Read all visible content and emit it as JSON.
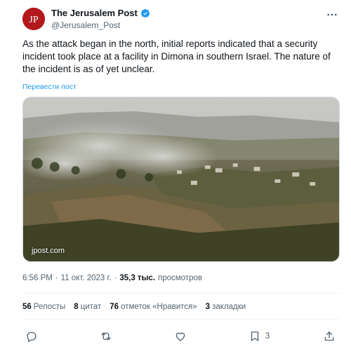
{
  "author": {
    "name": "The Jerusalem Post",
    "handle": "@Jerusalem_Post",
    "avatar_text": "JP"
  },
  "tweet": {
    "text": "As the attack began in the north, initial reports indicated that a security incident took place at a facility in Dimona in southern Israel. The nature of the incident is as of yet unclear.",
    "translate_label": "Перевести пост",
    "media_watermark": "jpost.com"
  },
  "meta": {
    "time": "6:56 PM",
    "separator": "·",
    "date": "11 окт. 2023 г.",
    "separator2": "·",
    "views_count": "35,3 тыс.",
    "views_label": "просмотров"
  },
  "stats": {
    "reposts_count": "56",
    "reposts_label": "Репосты",
    "quotes_count": "8",
    "quotes_label": "цитат",
    "likes_count": "76",
    "likes_label": "отметок «Нравится»",
    "bookmarks_count": "3",
    "bookmarks_label": "закладки"
  },
  "actions": {
    "bookmark_count": "3"
  },
  "icons": [
    "verified-icon",
    "more-icon",
    "reply-icon",
    "retweet-icon",
    "like-icon",
    "bookmark-icon",
    "share-icon"
  ],
  "colors": {
    "accent": "#1d9bf0",
    "avatar_bg": "#b3191c",
    "text_secondary": "#536471"
  }
}
